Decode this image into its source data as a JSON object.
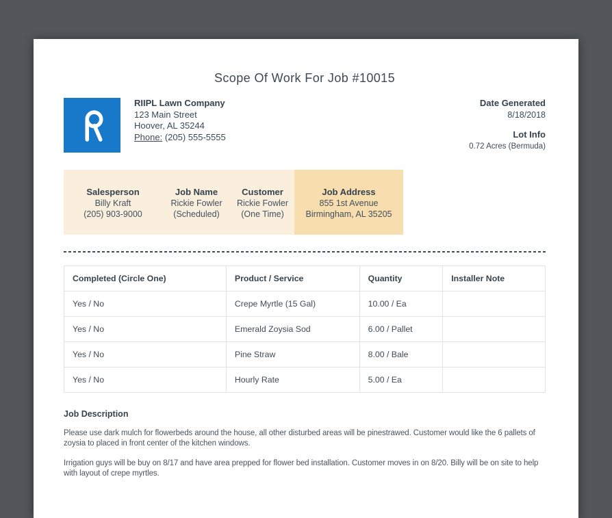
{
  "title": "Scope Of Work For Job #10015",
  "company": {
    "logo_letter": "R",
    "name": "RIIPL Lawn Company",
    "address_line1": "123 Main Street",
    "address_line2": "Hoover, AL 35244",
    "phone_label": "Phone:",
    "phone_number": "(205) 555-5555"
  },
  "meta": {
    "date_generated_label": "Date Generated",
    "date_generated": "8/18/2018",
    "lot_info_label": "Lot Info",
    "lot_info": "0.72 Acres (Bermuda)"
  },
  "job_info": {
    "salesperson": {
      "label": "Salesperson",
      "line1": "Billy Kraft",
      "line2": "(205) 903-9000"
    },
    "job_name": {
      "label": "Job Name",
      "line1": "Rickie Fowler",
      "line2": "(Scheduled)"
    },
    "customer": {
      "label": "Customer",
      "line1": "Rickie Fowler",
      "line2": "(One Time)"
    },
    "job_address": {
      "label": "Job Address",
      "line1": "855 1st Avenue",
      "line2": "Birmingham, AL 35205"
    }
  },
  "table": {
    "headers": [
      "Completed (Circle One)",
      "Product / Service",
      "Quantity",
      "Installer Note"
    ],
    "rows": [
      [
        "Yes / No",
        "Crepe Myrtle (15 Gal)",
        "10.00 / Ea",
        ""
      ],
      [
        "Yes / No",
        "Emerald Zoysia Sod",
        "6.00 / Pallet",
        ""
      ],
      [
        "Yes / No",
        "Pine Straw",
        "8.00 / Bale",
        ""
      ],
      [
        "Yes / No",
        "Hourly Rate",
        "5.00 / Ea",
        ""
      ]
    ]
  },
  "job_description": {
    "heading": "Job Description",
    "paragraphs": [
      "Please use dark mulch for flowerbeds around the house, all other disturbed areas will be pinestrawed. Customer would like the 6 pallets of zoysia to placed in front center of the kitchen windows.",
      "Irrigation guys will be buy on 8/17 and have area prepped for flower bed installation. Customer moves in on 8/20. Billy will be on site to help with layout of crepe myrtles."
    ]
  },
  "colors": {
    "page_background": "#53565b",
    "logo_blue": "#1878c9",
    "band_light": "#faeedd",
    "band_accent": "#f8ddae",
    "divider_navy": "#3c4a66",
    "text_dark": "#3d4a55"
  }
}
